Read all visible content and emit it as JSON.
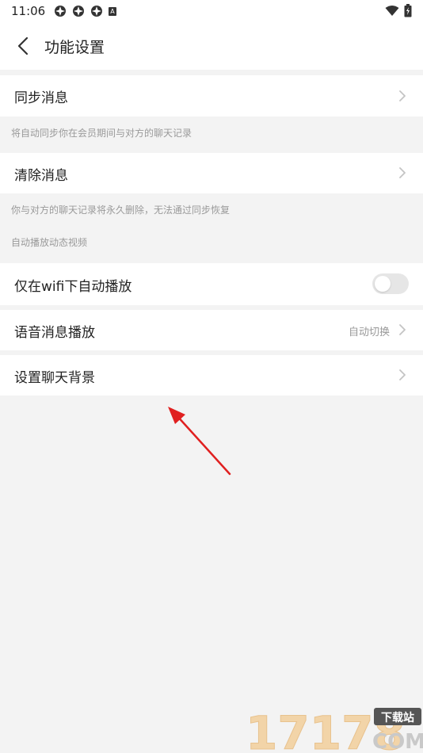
{
  "status": {
    "time": "11:06",
    "letter": "A"
  },
  "header": {
    "title": "功能设置"
  },
  "sync": {
    "label": "同步消息",
    "hint": "将自动同步你在会员期间与对方的聊天记录"
  },
  "clear": {
    "label": "清除消息",
    "hint": "你与对方的聊天记录将永久删除，无法通过同步恢复"
  },
  "autoplay": {
    "section_title": "自动播放动态视频",
    "wifi_label": "仅在wifi下自动播放",
    "wifi_enabled": false
  },
  "voice": {
    "label": "语音消息播放",
    "value": "自动切换"
  },
  "background": {
    "label": "设置聊天背景"
  },
  "watermark": {
    "number": "17178",
    "badge": "下载站",
    "suffix": "COM"
  },
  "colors": {
    "arrow": "#e02020",
    "toggle_off": "#e6e6e6",
    "hint": "#9a9a9a"
  }
}
